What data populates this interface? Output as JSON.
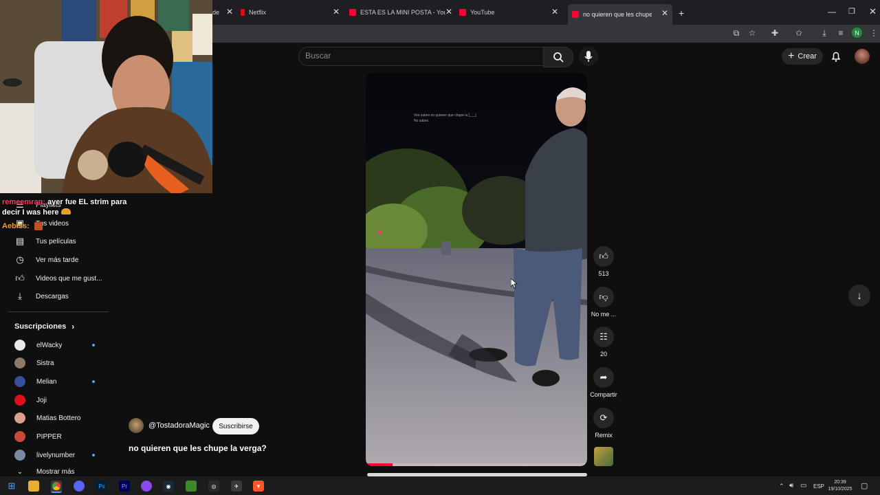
{
  "browser": {
    "tabs": [
      {
        "label": "de",
        "active": false
      },
      {
        "label": "Netflix",
        "active": false
      },
      {
        "label": "ESTA ES LA MINI POSTA - YouTu",
        "active": false
      },
      {
        "label": "YouTube",
        "active": false
      },
      {
        "label": "no quieren que les chupe la",
        "active": true
      }
    ],
    "new_tab": "+",
    "profile_initial": "N"
  },
  "youtube": {
    "search_placeholder": "Buscar",
    "create_label": "Crear",
    "sidebar": {
      "items": [
        {
          "label": "Playlists",
          "icon": "playlist-icon"
        },
        {
          "label": "Tus videos",
          "icon": "video-icon"
        },
        {
          "label": "Tus películas",
          "icon": "film-icon"
        },
        {
          "label": "Ver más tarde",
          "icon": "clock-icon"
        },
        {
          "label": "Videos que me gust...",
          "icon": "thumbs-up-icon"
        },
        {
          "label": "Descargas",
          "icon": "download-icon"
        }
      ],
      "subscriptions_title": "Suscripciones",
      "subscriptions": [
        {
          "name": "elWacky",
          "color": "#e8e8e8",
          "new": true
        },
        {
          "name": "Sistra",
          "color": "#8a7a6a",
          "new": false
        },
        {
          "name": "Melian",
          "color": "#3a4ea0",
          "new": true
        },
        {
          "name": "Joji",
          "color": "#e0101a",
          "new": false
        },
        {
          "name": "Matias Bottero",
          "color": "#d9a08a",
          "new": false
        },
        {
          "name": "PIPPER",
          "color": "#c94a3a",
          "new": false
        },
        {
          "name": "livelynumber",
          "color": "#7a8aa0",
          "new": true
        }
      ],
      "show_more": "Mostrar más"
    },
    "short": {
      "channel": "@TostadoraMagic",
      "subscribe_label": "Suscribirse",
      "title": "no quieren que les chupe la verga?",
      "overlay_text": [
        "Vos sabes no quieren que chupe la [___]",
        "No sabes"
      ],
      "progress": 0.12,
      "likes": "513",
      "dislike_label": "No me ...",
      "comments": "20",
      "share_label": "Compartir",
      "remix_label": "Remix"
    }
  },
  "stream_chat": {
    "user1": "remeemran:",
    "message1": "ayer fue EL strim para decir I was here",
    "user2": "Aebiss:"
  },
  "taskbar": {
    "language": "ESP",
    "time": "20:39",
    "date": "19/10/2025"
  }
}
